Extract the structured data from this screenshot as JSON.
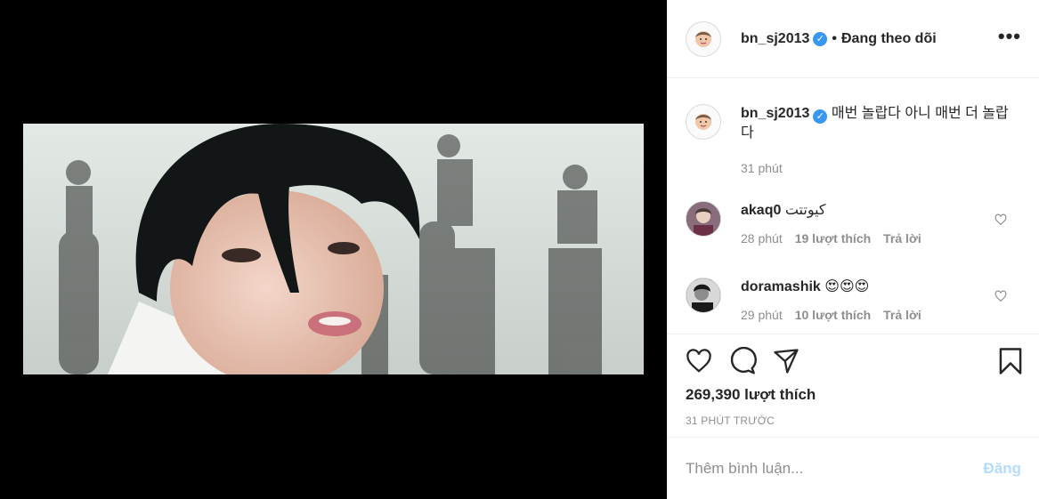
{
  "post": {
    "author": "bn_sj2013",
    "follow_status": "Đang theo dõi",
    "caption": "매번 놀랍다 아니 매번 더 놀랍다",
    "caption_time": "31 phút",
    "likes": "269,390 lượt thích",
    "time_ago": "31 PHÚT TRƯỚC"
  },
  "comments": [
    {
      "user": "akaq0",
      "text": "کیوتتت",
      "time": "28 phút",
      "likes": "19 lượt thích",
      "reply": "Trả lời"
    },
    {
      "user": "doramashik",
      "text": "😍😍😍",
      "time": "29 phút",
      "likes": "10 lượt thích",
      "reply": "Trả lời"
    }
  ],
  "add_comment": {
    "placeholder": "Thêm bình luận...",
    "post_label": "Đăng"
  },
  "icons": {
    "verified": "verified-badge-icon",
    "more": "more-options-icon",
    "like": "heart-icon",
    "comment": "comment-icon",
    "share": "share-icon",
    "save": "bookmark-icon"
  },
  "colors": {
    "verified": "#3897f0",
    "post_disabled": "#b3dbff",
    "muted": "#8e8e8e"
  }
}
